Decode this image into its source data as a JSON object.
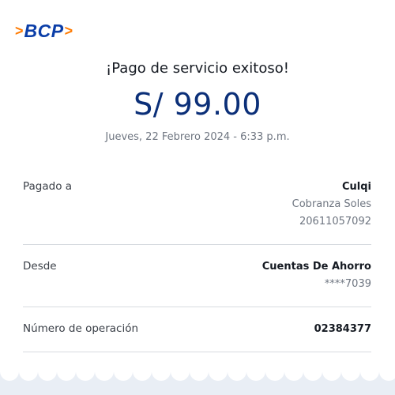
{
  "brand": {
    "name": "BCP",
    "accent": "#ff7a00",
    "primary": "#0b3ea8"
  },
  "receipt": {
    "title": "¡Pago de servicio exitoso!",
    "amount": "S/ 99.00",
    "datetime": "Jueves, 22 Febrero 2024 - 6:33 p.m."
  },
  "details": {
    "paid_to": {
      "label": "Pagado a",
      "name": "Culqi",
      "line2": "Cobranza Soles",
      "line3": "20611057092"
    },
    "from": {
      "label": "Desde",
      "account_type": "Cuentas De Ahorro",
      "account_mask": "****7039"
    },
    "operation": {
      "label": "Número de operación",
      "value": "02384377"
    }
  }
}
